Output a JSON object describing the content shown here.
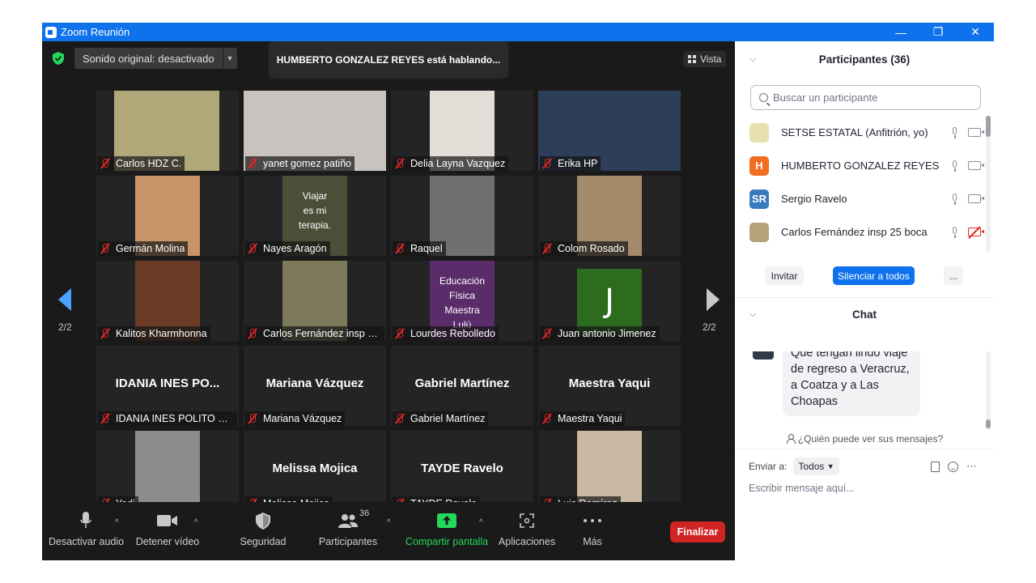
{
  "window": {
    "title": "Zoom Reunión",
    "controls": [
      "—",
      "❐",
      "✕"
    ]
  },
  "meeting": {
    "audio_original": "Sonido original: desactivado",
    "speaking_banner": "HUMBERTO GONZALEZ REYES está hablando...",
    "view_label": "Vista",
    "page_indicator": "2/2"
  },
  "tiles": [
    {
      "name": "Carlos HDZ C.",
      "display": "photo",
      "photo_color": "#b0a878"
    },
    {
      "name": "yanet gomez patiño",
      "display": "photo",
      "photo_color": "#c9c3c0"
    },
    {
      "name": "Delia Layna Vazquez",
      "display": "photo",
      "photo_color": "#e3ddd7"
    },
    {
      "name": "Erika HP",
      "display": "photo",
      "photo_color": "#2c3e58"
    },
    {
      "name": "Germán Molina",
      "display": "photo",
      "photo_color": "#c99468"
    },
    {
      "name": "Nayes Aragón",
      "display": "photo",
      "photo_color": "#4a4f38",
      "photo_text": [
        "Viajar",
        "es mi",
        "terapia."
      ]
    },
    {
      "name": "Raquel",
      "display": "photo",
      "photo_color": "#707070"
    },
    {
      "name": "Colom Rosado",
      "display": "photo",
      "photo_color": "#a48b6c"
    },
    {
      "name": "Kalitos Kharmhonna",
      "display": "photo",
      "photo_color": "#6b3b26"
    },
    {
      "name": "Carlos Fernández insp 25 boca",
      "display": "photo",
      "photo_color": "#7c7a5a"
    },
    {
      "name": "Lourdes Rebolledo",
      "display": "photo",
      "photo_color": "#5b2c6a",
      "photo_text": [
        "Educación Física",
        "Maestra",
        "Lulú"
      ]
    },
    {
      "name": "Juan antonio Jimenez",
      "display": "initial",
      "initial": "J",
      "photo_color": "#2d6b1e"
    },
    {
      "name": "IDANIA INES POLITO CHAN",
      "display": "name",
      "big": "IDANIA INES PO..."
    },
    {
      "name": "Mariana Vázquez",
      "display": "name",
      "big": "Mariana Vázquez"
    },
    {
      "name": "Gabriel Martínez",
      "display": "name",
      "big": "Gabriel Martínez"
    },
    {
      "name": "Maestra Yaqui",
      "display": "name",
      "big": "Maestra Yaqui"
    },
    {
      "name": "Yedi",
      "display": "photo",
      "photo_color": "#8c8c8c"
    },
    {
      "name": "Melissa Mojica",
      "display": "name",
      "big": "Melissa Mojica"
    },
    {
      "name": "TAYDE Ravelo",
      "display": "name",
      "big": "TAYDE Ravelo"
    },
    {
      "name": "Luis Ramírez",
      "display": "photo",
      "photo_color": "#c8b8a4"
    }
  ],
  "toolbar": {
    "mute": "Desactivar audio",
    "video": "Detener vídeo",
    "security": "Seguridad",
    "participants": "Participantes",
    "participants_count": "36",
    "share": "Compartir pantalla",
    "apps": "Aplicaciones",
    "more": "Más",
    "end": "Finalizar"
  },
  "panel": {
    "participants_header": "Participantes (36)",
    "search_placeholder": "Buscar un participante",
    "participants": [
      {
        "name": "SETSE ESTATAL (Anfitrión, yo)",
        "avatar": "",
        "avatar_color": "#e8e0b0",
        "cam_off": false
      },
      {
        "name": "HUMBERTO GONZALEZ REYES",
        "avatar": "H",
        "avatar_color": "#f26d21",
        "cam_off": false
      },
      {
        "name": "Sergio Ravelo",
        "avatar": "SR",
        "avatar_color": "#3a7bbf",
        "cam_off": false
      },
      {
        "name": "Carlos Fernández insp 25 boca",
        "avatar": "",
        "avatar_color": "#b4a27a",
        "cam_off": true
      }
    ],
    "invite": "Invitar",
    "mute_all": "Silenciar a todos",
    "more": "...",
    "chat_header": "Chat",
    "chat_message": "Que tengan lindo viaje de regreso a Veracruz, a Coatza y a Las Choapas",
    "who_can_see": "¿Quién puede ver sus mensajes?",
    "send_to_label": "Enviar a:",
    "send_to_value": "Todos",
    "message_placeholder": "Escribir mensaje aquí..."
  }
}
